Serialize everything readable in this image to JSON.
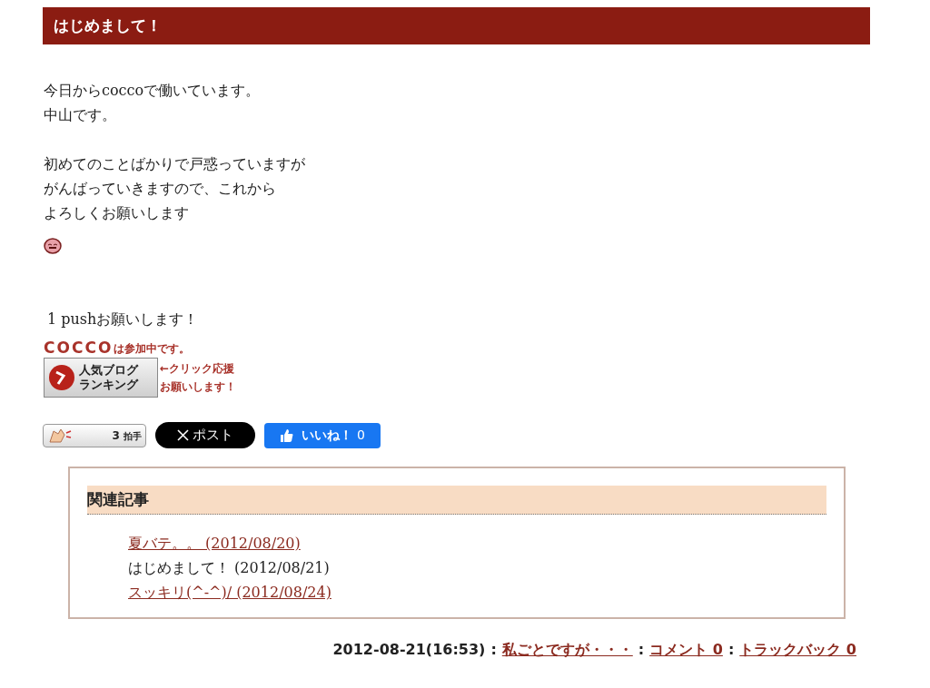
{
  "title": "はじめまして！",
  "paragraphs": [
    [
      "今日からcoccoで働いています。",
      "中山です。"
    ],
    [
      "初めてのことばかりで戸惑っていますが",
      "がんばっていきますので、これから",
      "よろしくお願いします"
    ]
  ],
  "push_text": "1 pushお願いします！",
  "ranking_banner": {
    "brand": "COCCO",
    "joined": "は参加中です。",
    "badge_line1": "人気ブログ",
    "badge_line2": "ランキング",
    "note_line1": "←クリック応援",
    "note_line2": "お願いします！"
  },
  "share": {
    "clap_count": "3",
    "clap_label": "拍手",
    "post_label": "ポスト",
    "like_label": "いいね！",
    "like_count": "0"
  },
  "related": {
    "heading": "関連記事",
    "items": [
      {
        "text": "夏バテ。。 (2012/08/20)",
        "selected": false
      },
      {
        "text": "はじめまして！ (2012/08/21)",
        "selected": true
      },
      {
        "text": "スッキリ(^-^)/ (2012/08/24)",
        "selected": false
      }
    ]
  },
  "footer": {
    "datetime": "2012-08-21(16:53)",
    "category": "私ごとですが・・・",
    "comments": "コメント 0",
    "trackbacks": "トラックバック 0",
    "separator": ":"
  }
}
